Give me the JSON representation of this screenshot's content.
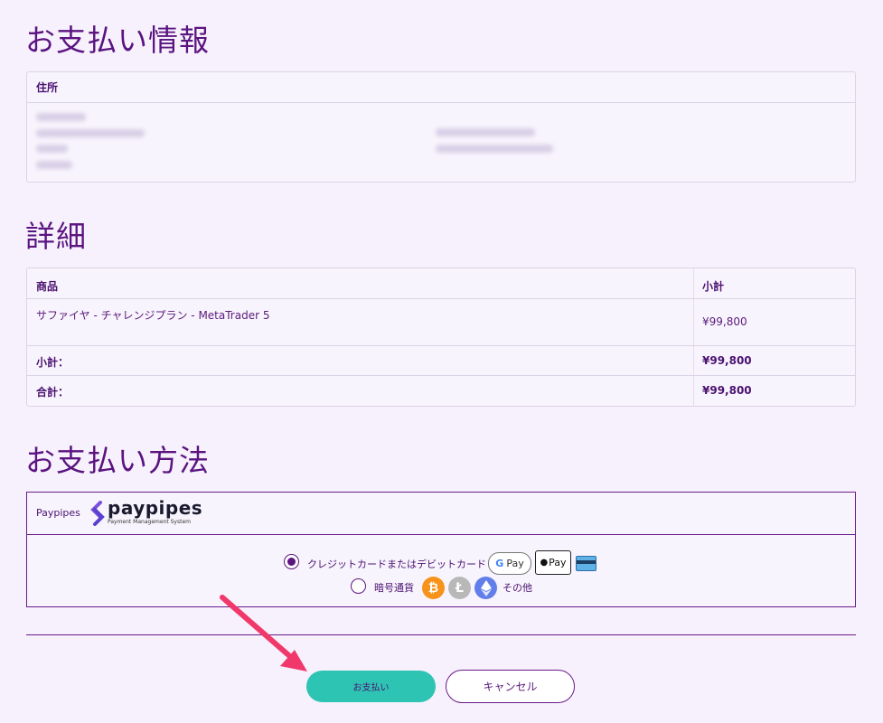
{
  "sections": {
    "payment_info_title": "お支払い情報",
    "details_title": "詳細",
    "payment_method_title": "お支払い方法"
  },
  "address": {
    "header": "住所"
  },
  "details": {
    "col_product": "商品",
    "col_subtotal": "小計",
    "item_name": "サファイヤ - チャレンジプラン - MetaTrader 5",
    "item_price": "¥99,800",
    "subtotal_label": "小計：",
    "subtotal_value": "¥99,800",
    "total_label": "合計：",
    "total_value": "¥99,800"
  },
  "payment": {
    "provider_label": "Paypipes",
    "logo_text": "paypipes",
    "logo_tagline": "Payment Management System",
    "option_card": "クレジットカードまたはデビットカード",
    "option_crypto": "暗号通貨",
    "gpay_label": "G Pay",
    "applepay_label": "Pay",
    "crypto_other": "その他"
  },
  "buttons": {
    "pay": "お支払い",
    "cancel": "キャンセル"
  },
  "colors": {
    "accent_purple": "#5b1480",
    "teal_button": "#2ec4b3",
    "arrow": "#f0386b"
  }
}
